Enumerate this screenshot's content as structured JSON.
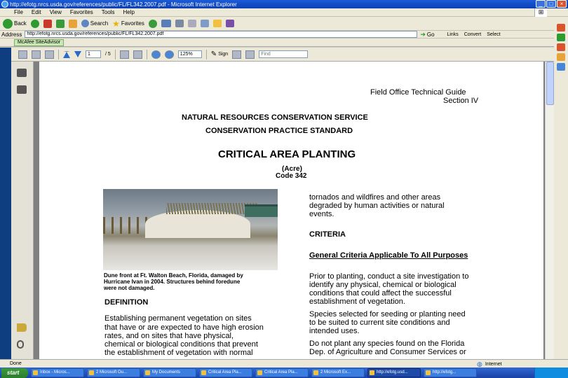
{
  "browser": {
    "title": "http://efotg.nrcs.usda.gov/references/public/FL/FL342.2007.pdf - Microsoft Internet Explorer",
    "menu": [
      "File",
      "Edit",
      "View",
      "Favorites",
      "Tools",
      "Help"
    ],
    "nav": {
      "back": "Back",
      "search": "Search",
      "favorites": "Favorites"
    },
    "address_label": "Address",
    "address_value": "http://efotg.nrcs.usda.gov/references/public/FL/FL342.2007.pdf",
    "go_label": "Go",
    "links_label": "Links",
    "convert_label": "Convert",
    "select_label": "Select",
    "links_button": "McAfee SiteAdvisor"
  },
  "pdf_toolbar": {
    "page_number": "1",
    "page_total": "/ 5",
    "zoom": "125%",
    "sign_label": "Sign",
    "find_placeholder": "Find"
  },
  "document": {
    "header_line1": "Field Office Technical Guide",
    "header_line2": "Section IV",
    "agency": "NATURAL RESOURCES CONSERVATION SERVICE",
    "standard": "CONSERVATION PRACTICE STANDARD",
    "title": "CRITICAL AREA PLANTING",
    "unit": "(Acre)",
    "code": "Code 342",
    "caption_line1": "Dune front at Ft. Walton Beach, Florida, damaged by",
    "caption_line2": "Hurricane Ivan in 2004.  Structures behind foredune",
    "caption_line3": "were not damaged.",
    "definition_heading": "DEFINITION",
    "definition_lines": [
      "Establishing permanent vegetation on sites",
      "that have or are expected to have high erosion",
      "rates, and on sites that have physical,",
      "chemical or biological conditions that prevent",
      "the establishment of vegetation with normal"
    ],
    "right_lines_top": [
      "tornados and wildfires and other areas",
      "degraded by human activities or natural",
      "events."
    ],
    "criteria_heading": "CRITERIA",
    "general_criteria_heading": "General Criteria Applicable To All Purposes",
    "para1_lines": [
      "Prior to planting, conduct a site investigation to",
      "identify any physical, chemical or biological",
      "conditions that could affect the successful",
      "establishment of vegetation."
    ],
    "para2_lines": [
      "Species selected for seeding or planting need",
      "to be suited to current site conditions and",
      "intended uses."
    ],
    "para3_lines": [
      "Do not plant any species found on the Florida",
      "Dep. of Agriculture and Consumer Services or"
    ]
  },
  "status": {
    "done_label": "Done",
    "zone_label": "Internet"
  },
  "taskbar": {
    "start_label": "start",
    "items": [
      "Inbox - Micros...",
      "2 Microsoft Ou...",
      "My Documents",
      "Critical Area Pla...",
      "Critical Area Pla...",
      "2 Microsoft Ex...",
      "http://efotg.usd...",
      "http://efotg..."
    ]
  }
}
